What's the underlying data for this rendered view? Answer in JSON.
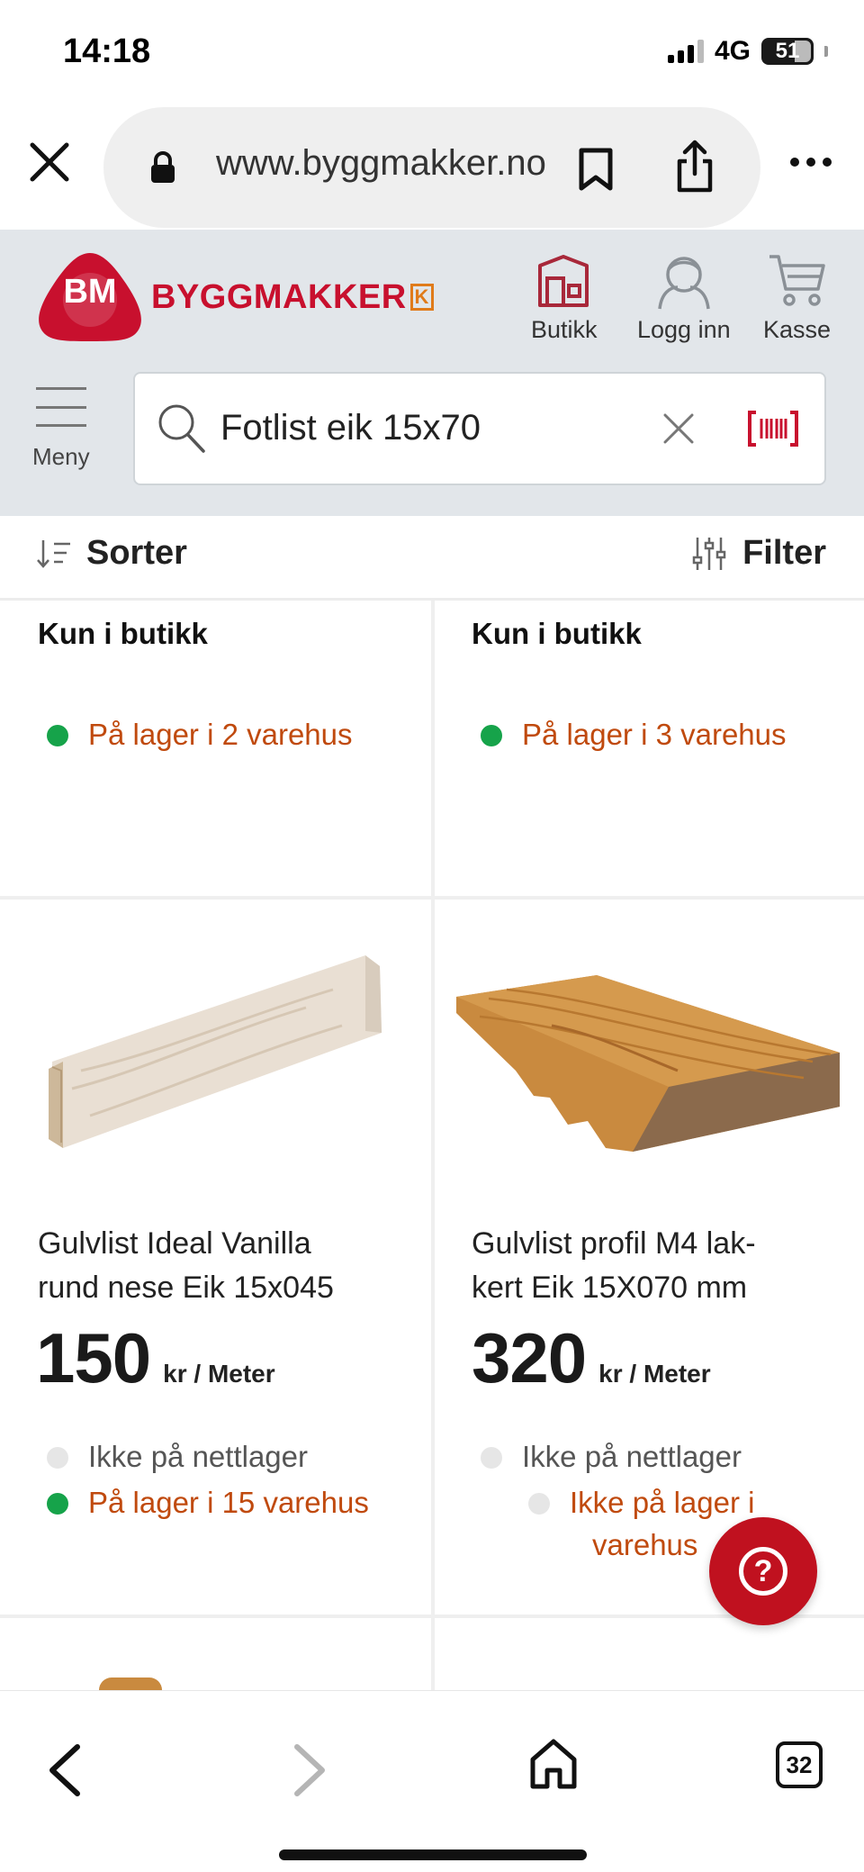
{
  "status_bar": {
    "time": "14:18",
    "network": "4G",
    "battery": "51"
  },
  "browser": {
    "url": "www.byggmakker.no"
  },
  "site_header": {
    "logo_mark": "BM",
    "logo_text": "BYGGMAKKER",
    "logo_badge": "K",
    "store_label": "Butikk",
    "login_label": "Logg inn",
    "cart_label": "Kasse",
    "menu_label": "Meny",
    "search_value": "Fotlist eik 15x70"
  },
  "sort_bar": {
    "sort_label": "Sorter",
    "filter_label": "Filter"
  },
  "products": [
    {
      "badge": "Kun i butikk",
      "store_stock": "På lager i 2 varehus",
      "store_stock_color": "green"
    },
    {
      "badge": "Kun i butikk",
      "store_stock": "På lager i 3 varehus",
      "store_stock_color": "green"
    },
    {
      "name_line1": "Gulvlist Ideal Vanilla",
      "name_line2": "rund nese Eik 15x045",
      "price": "150",
      "unit": "kr / Meter",
      "online_stock": "Ikke på nettlager",
      "store_stock": "På lager i 15 varehus",
      "image": "light-oak-moulding-icon"
    },
    {
      "name_line1": "Gulvlist profil M4 lak-",
      "name_line2": "kert Eik 15X070 mm",
      "price": "320",
      "unit": "kr / Meter",
      "online_stock": "Ikke på nettlager",
      "store_stock_line1": "Ikke på lager i",
      "store_stock_line2": "varehus",
      "image": "lacquered-oak-moulding-icon"
    }
  ],
  "help": {
    "symbol": "?"
  },
  "toolbar": {
    "tab_count": "32"
  },
  "colors": {
    "brand_red": "#c8102e",
    "accent_orange": "#c04a0e",
    "in_stock_green": "#16a34a"
  }
}
